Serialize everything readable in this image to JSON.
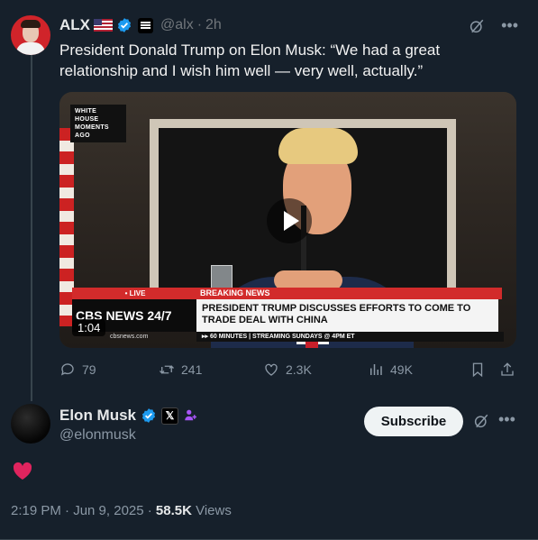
{
  "tweet": {
    "author_name": "ALX",
    "handle": "@alx",
    "separator": "·",
    "time": "2h",
    "text": "President Donald Trump on Elon Musk: “We had a great relationship and I wish him well — very well, actually.”",
    "media": {
      "corner_tag": "WHITE HOUSE MOMENTS AGO",
      "live_label": "• LIVE",
      "breaking_label": "BREAKING NEWS",
      "network": "CBS NEWS 24/7",
      "headline": "PRESIDENT TRUMP DISCUSSES EFFORTS TO COME TO TRADE DEAL WITH CHINA",
      "ticker": "▸▸ 60 MINUTES | STREAMING SUNDAYS @ 4PM ET",
      "url": "cbsnews.com",
      "duration": "1:04"
    },
    "stats": {
      "replies": "79",
      "reposts": "241",
      "likes": "2.3K",
      "views": "49K"
    }
  },
  "reply": {
    "author_name": "Elon Musk",
    "handle": "@elonmusk",
    "x_badge": "𝕏",
    "subscribe_label": "Subscribe"
  },
  "footer": {
    "time": "2:19 PM · Jun 9, 2025 · ",
    "views_count": "58.5K",
    "views_label": " Views"
  },
  "colors": {
    "background": "#16202b",
    "verified": "#1d9bf0",
    "heart": "#f91880",
    "muted": "#8b98a5"
  }
}
